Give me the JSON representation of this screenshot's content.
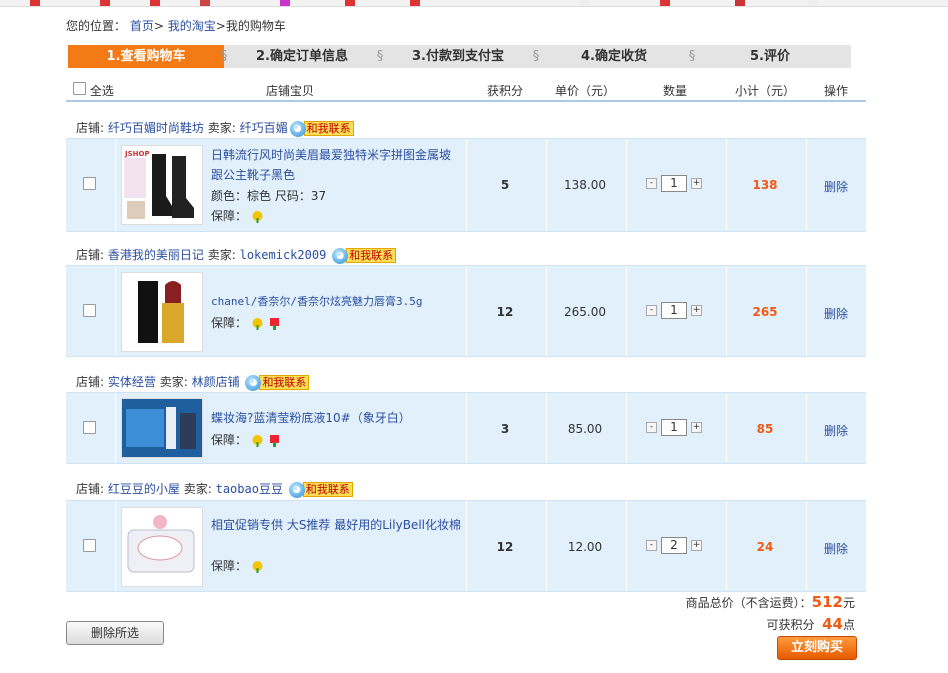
{
  "breadcrumb": {
    "prefix": "您的位置：",
    "home": "首页",
    "sep1": ">",
    "taobao": "我的淘宝",
    "sep2": ">",
    "current": "我的购物车"
  },
  "steps": [
    "1.查看购物车",
    "2.确定订单信息",
    "3.付款到支付宝",
    "4.确定收货",
    "5.评价"
  ],
  "table_header": {
    "select_all": "全选",
    "item": "店铺宝贝",
    "points": "获积分",
    "unit_price": "单价（元）",
    "quantity": "数量",
    "subtotal": "小计（元）",
    "action": "操作"
  },
  "contact_label": "和我联系",
  "stores": [
    {
      "store_label": "店铺:",
      "store": "纤巧百媚时尚鞋坊",
      "seller_label": "卖家:",
      "seller": "纤巧百媚",
      "item": {
        "title": "日韩流行风时尚美眉最爱独特米字拼图金属坡跟公主靴子黑色",
        "attr": "颜色：棕色  尺码：37",
        "guarantee": "保障：",
        "points": "5",
        "price": "138.00",
        "qty": "1",
        "subtotal": "138",
        "delete": "删除"
      }
    },
    {
      "store_label": "店铺:",
      "store": "香港我的美丽日记",
      "seller_label": "卖家:",
      "seller": "lokemick2009",
      "item": {
        "title": "chanel/香奈尔/香奈尔炫亮魅力唇膏3.5g",
        "attr": "",
        "guarantee": "保障：",
        "points": "12",
        "price": "265.00",
        "qty": "1",
        "subtotal": "265",
        "delete": "删除"
      }
    },
    {
      "store_label": "店铺:",
      "store": "实体经营",
      "seller_label": "卖家:",
      "seller": "林颜店铺",
      "item": {
        "title": "蝶妆海?蓝清莹粉底液10#（象牙白）",
        "attr": "",
        "guarantee": "保障：",
        "points": "3",
        "price": "85.00",
        "qty": "1",
        "subtotal": "85",
        "delete": "删除"
      }
    },
    {
      "store_label": "店铺:",
      "store": "红豆豆的小屋",
      "seller_label": "卖家:",
      "seller": "taobao豆豆",
      "item": {
        "title": "相宜促销专供 大S推荐 最好用的LilyBell化妆棉",
        "attr": "",
        "guarantee": "保障：",
        "points": "12",
        "price": "12.00",
        "qty": "2",
        "subtotal": "24",
        "delete": "删除"
      }
    }
  ],
  "summary": {
    "total_label": "商品总价（不含运费）：",
    "total": "512",
    "total_unit": "元",
    "earn_label": "可获积分",
    "earn": "44",
    "earn_unit": "点"
  },
  "buttons": {
    "delete_selected": "删除所选",
    "buy_now": "立刻购买"
  },
  "thumb_text": {
    "boots_brand": "JSHOP"
  },
  "colors": {
    "accent": "#f37a14",
    "link": "#2b4ea0",
    "row_bg": "#e1f0fb",
    "price_red": "#f05a14"
  }
}
